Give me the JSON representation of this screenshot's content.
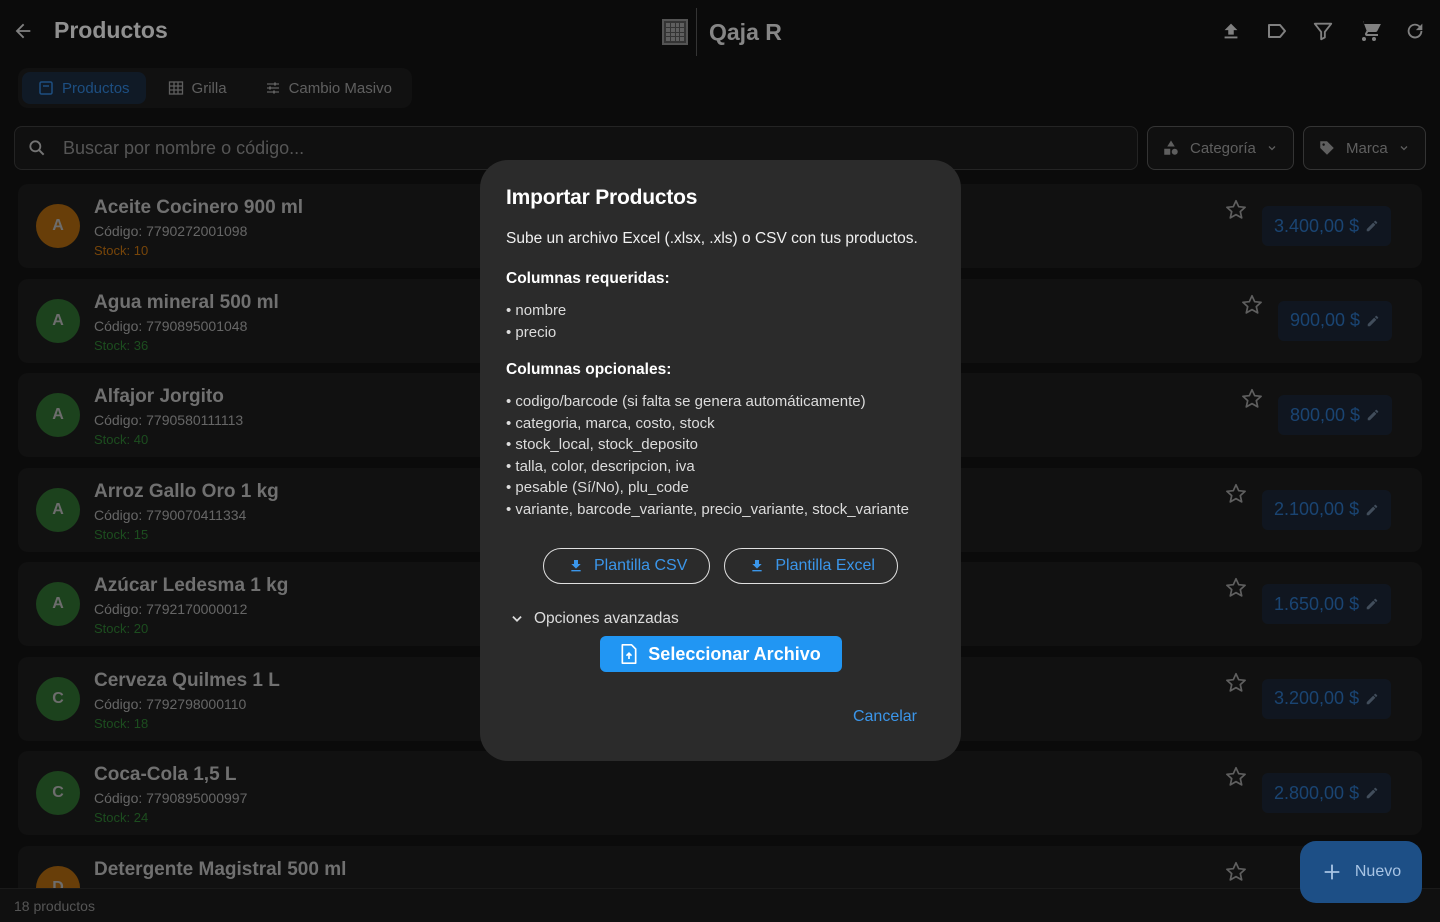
{
  "app": {
    "title": "Productos",
    "brand": "Qaja R"
  },
  "tabs": [
    {
      "label": "Productos",
      "icon": "product-box-icon",
      "active": true
    },
    {
      "label": "Grilla",
      "icon": "grid-icon",
      "active": false
    },
    {
      "label": "Cambio Masivo",
      "icon": "tune-icon",
      "active": false
    }
  ],
  "search": {
    "placeholder": "Buscar por nombre o código..."
  },
  "filters": {
    "category": "Categoría",
    "brand": "Marca"
  },
  "products": [
    {
      "initial": "A",
      "name": "Aceite Cocinero 900 ml",
      "code": "Código: 7790272001098",
      "stock": "Stock: 10",
      "price": "3.400,00 $",
      "avatar_color": "#a8650f",
      "stock_color": "#c07010"
    },
    {
      "initial": "A",
      "name": "Agua mineral 500 ml",
      "code": "Código: 7790895001048",
      "stock": "Stock: 36",
      "price": "900,00 $",
      "avatar_color": "#2e6b30",
      "stock_color": "#2e7d32"
    },
    {
      "initial": "A",
      "name": "Alfajor Jorgito",
      "code": "Código: 7790580111113",
      "stock": "Stock: 40",
      "price": "800,00 $",
      "avatar_color": "#2e6b30",
      "stock_color": "#2e7d32"
    },
    {
      "initial": "A",
      "name": "Arroz Gallo Oro 1 kg",
      "code": "Código: 7790070411334",
      "stock": "Stock: 15",
      "price": "2.100,00 $",
      "avatar_color": "#2e6b30",
      "stock_color": "#2e7d32"
    },
    {
      "initial": "A",
      "name": "Azúcar Ledesma 1 kg",
      "code": "Código: 7792170000012",
      "stock": "Stock: 20",
      "price": "1.650,00 $",
      "avatar_color": "#2e6b30",
      "stock_color": "#2e7d32"
    },
    {
      "initial": "C",
      "name": "Cerveza Quilmes 1 L",
      "code": "Código: 7792798000110",
      "stock": "Stock: 18",
      "price": "3.200,00 $",
      "avatar_color": "#2e6b30",
      "stock_color": "#2e7d32"
    },
    {
      "initial": "C",
      "name": "Coca-Cola 1,5 L",
      "code": "Código: 7790895000997",
      "stock": "Stock: 24",
      "price": "2.800,00 $",
      "avatar_color": "#2e6b30",
      "stock_color": "#2e7d32"
    },
    {
      "initial": "D",
      "name": "Detergente Magistral 500 ml",
      "code": "",
      "stock": "",
      "price": "",
      "avatar_color": "#a8650f",
      "stock_color": "#c07010"
    }
  ],
  "footer": {
    "count": "18 productos"
  },
  "fab": {
    "label": "Nuevo"
  },
  "dialog": {
    "title": "Importar Productos",
    "intro": "Sube un archivo Excel (.xlsx, .xls) o CSV con tus productos.",
    "required_title": "Columnas requeridas:",
    "required": [
      "• nombre",
      "• precio"
    ],
    "optional_title": "Columnas opcionales:",
    "optional": [
      "• codigo/barcode (si falta se genera automáticamente)",
      "• categoria, marca, costo, stock",
      "• stock_local, stock_deposito",
      "• talla, color, descripcion, iva",
      "• pesable (Sí/No), plu_code",
      "• variante, barcode_variante, precio_variante, stock_variante"
    ],
    "template_csv": "Plantilla CSV",
    "template_excel": "Plantilla Excel",
    "advanced": "Opciones avanzadas",
    "select_file": "Seleccionar Archivo",
    "cancel": "Cancelar"
  }
}
